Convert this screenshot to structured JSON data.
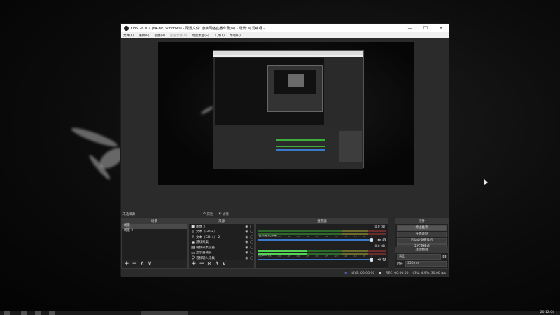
{
  "window": {
    "title": "OBS 26.0.2 (64-bit, windows) - 配置文件: 游族网络直播专场(iv) - 场景: 可爱嘛呀 -",
    "minimize_glyph": "—",
    "maximize_glyph": "☐",
    "close_glyph": "✕"
  },
  "menu": {
    "items": [
      "文件(F)",
      "编辑(E)",
      "视图(V)",
      "配置文件(P)",
      "场景集合(S)",
      "工具(T)",
      "帮助(H)"
    ]
  },
  "source_toolbar": {
    "no_source": "未选择源",
    "properties": "属性",
    "filters": "滤镜"
  },
  "docks": {
    "scenes": {
      "title": "场景",
      "items": [
        "场景",
        "场景 2"
      ],
      "selected_index": 0
    },
    "sources": {
      "title": "来源",
      "items": [
        {
          "icon": "image-icon",
          "glyph": "▣",
          "name": "图像 2"
        },
        {
          "icon": "text-icon",
          "glyph": "T",
          "name": "文本（GDI+）"
        },
        {
          "icon": "text-icon",
          "glyph": "T",
          "name": "文本（GDI+） 2"
        },
        {
          "icon": "game-capture-icon",
          "glyph": "◈",
          "name": "游戏采集"
        },
        {
          "icon": "video-capture-icon",
          "glyph": "▤",
          "name": "视频采集设备"
        },
        {
          "icon": "display-capture-icon",
          "glyph": "▭",
          "name": "显示器捕获"
        },
        {
          "icon": "microphone-icon",
          "glyph": "♀",
          "name": "音频输入采集"
        }
      ]
    },
    "mixer": {
      "title": "混音器",
      "tracks": [
        {
          "name": "音频输入采集",
          "db": "0.0 dB",
          "level": 0.0
        },
        {
          "name": "桌面音频",
          "db": "0.0 dB",
          "level": 0.38
        }
      ],
      "ticks": [
        "-60",
        "-55",
        "-50",
        "-45",
        "-40",
        "-35",
        "-30",
        "-25",
        "-20",
        "-15",
        "-10",
        "-5",
        "0"
      ]
    },
    "controls": {
      "title": "控件",
      "buttons": [
        "停止推流",
        "开始录制",
        "启动虚拟摄像机",
        "工作室模式",
        "设置",
        "退出"
      ]
    },
    "transitions": {
      "title": "转场特效",
      "selected": "淡出",
      "duration_label": "时长",
      "duration_value": "350 ms"
    }
  },
  "footer_glyphs": {
    "add": "+",
    "remove": "−",
    "gear": "⚙",
    "up": "∧",
    "down": "∨"
  },
  "status": {
    "live": "LIVE: 00:00:00",
    "rec": "REC: 00:00:00",
    "cpu": "CPU: 4.9%, 30.00 fps"
  },
  "taskbar": {
    "clock": "20:12:04"
  },
  "colors": {
    "meter_green": "#54d454",
    "slider_blue": "#3a78c9",
    "dock_bg": "#232323",
    "window_bg": "#2a2a2a"
  }
}
